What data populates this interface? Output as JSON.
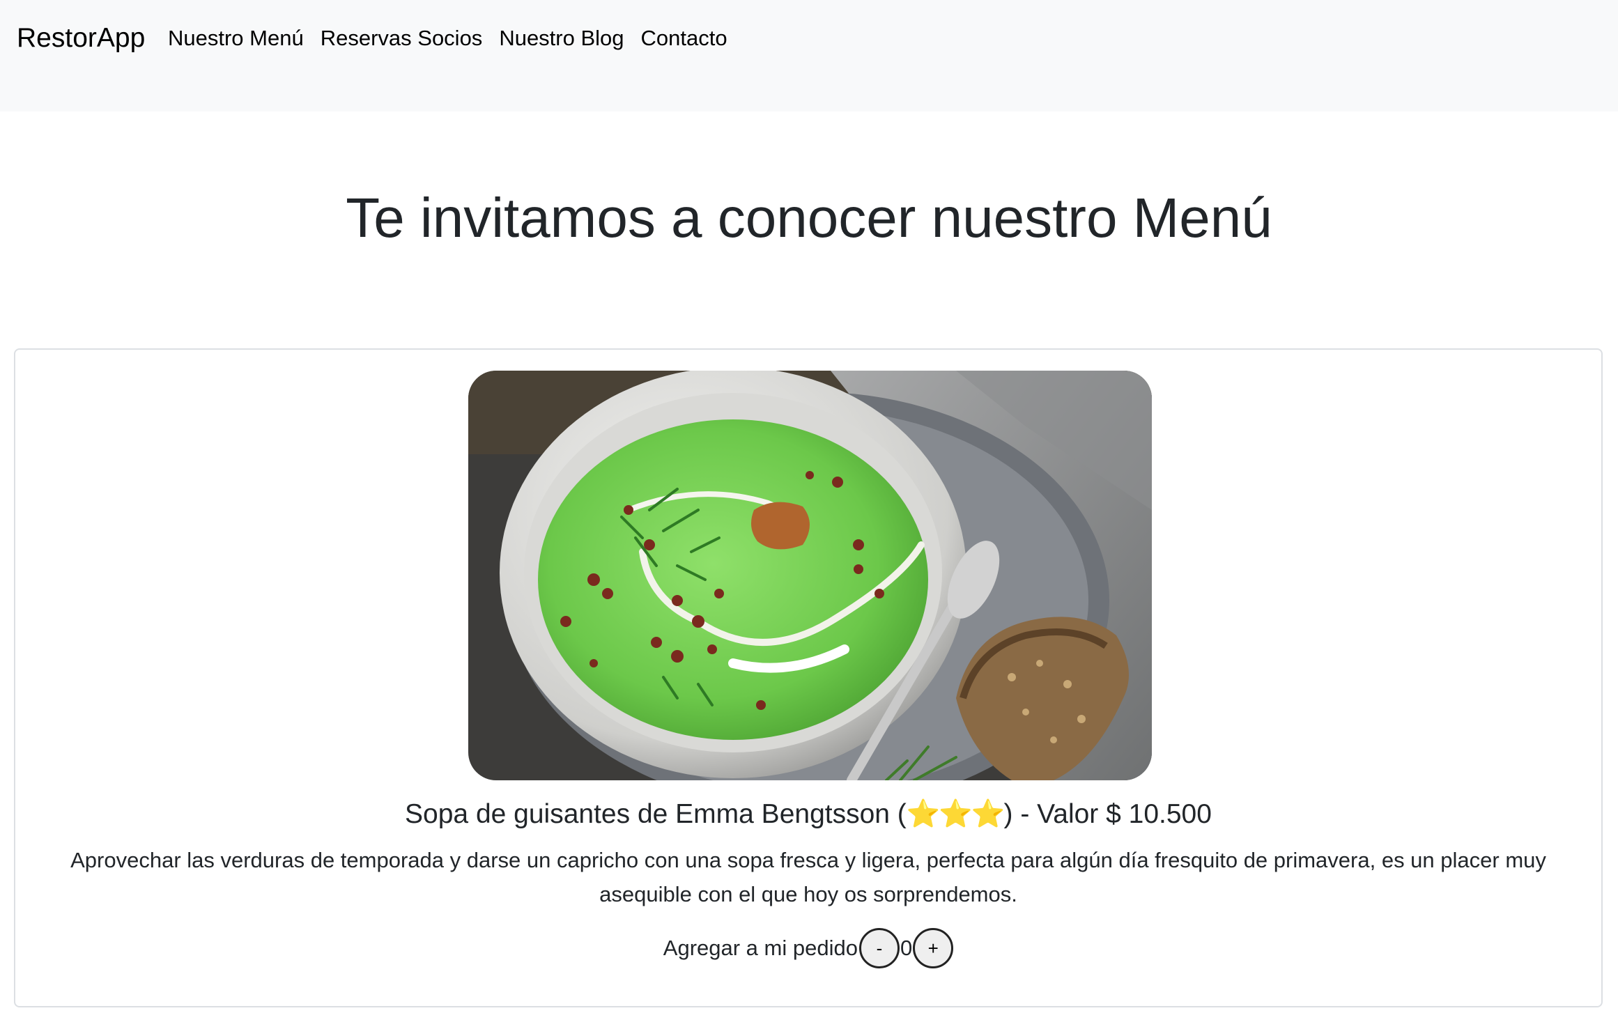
{
  "navbar": {
    "brand": "RestorApp",
    "links": [
      "Nuestro Menú",
      "Reservas Socios",
      "Nuestro Blog",
      "Contacto"
    ]
  },
  "page": {
    "title": "Te invitamos a conocer nuestro Menú"
  },
  "menu_item": {
    "name_prefix": "Sopa de guisantes de Emma Bengtsson (",
    "stars": "⭐⭐⭐",
    "name_suffix": ") - Valor $ 10.500",
    "rating_stars": 3,
    "description": "Aprovechar las verduras de temporada y darse un capricho con una sopa fresca y ligera, perfecta para algún día fresquito de primavera, es un placer muy asequible con el que hoy os sorprendemos.",
    "order_label": "Agregar a mi pedido",
    "minus_label": "-",
    "quantity": "0",
    "plus_label": "+"
  }
}
